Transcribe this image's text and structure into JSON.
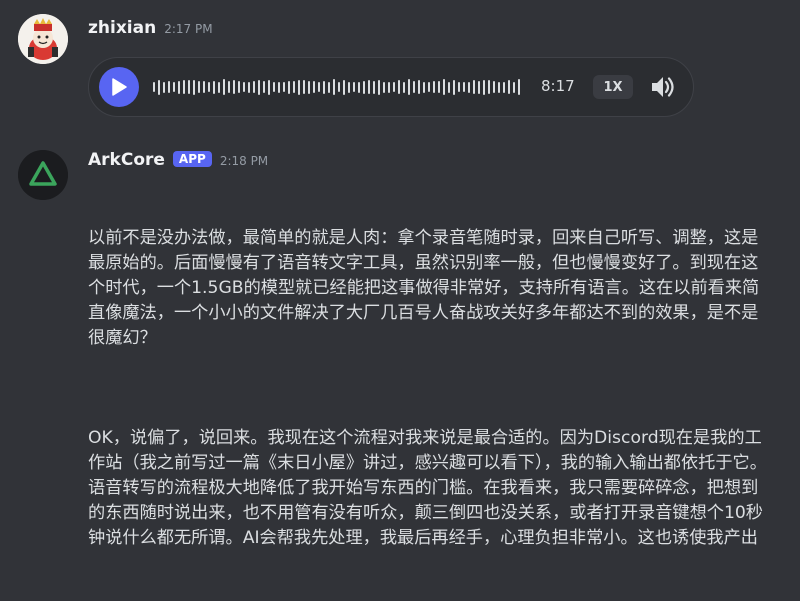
{
  "messages": [
    {
      "username": "zhixian",
      "timestamp": "2:17 PM",
      "avatar": "red-crowned-character-avatar",
      "voice": {
        "duration": "8:17",
        "speed": "1X",
        "play_icon": "play-icon",
        "volume_icon": "speaker-icon"
      }
    },
    {
      "username": "ArkCore",
      "badge": "APP",
      "timestamp": "2:18 PM",
      "avatar": "green-triangle-avatar",
      "paragraphs": [
        "以前不是没办法做，最简单的就是人肉：拿个录音笔随时录，回来自己听写、调整，这是最原始的。后面慢慢有了语音转文字工具，虽然识别率一般，但也慢慢变好了。到现在这个时代，一个1.5GB的模型就已经能把这事做得非常好，支持所有语言。这在以前看来简直像魔法，一个小小的文件解决了大厂几百号人奋战攻关好多年都达不到的效果，是不是很魔幻？",
        "OK，说偏了，说回来。我现在这个流程对我来说是最合适的。因为Discord现在是我的工作站（我之前写过一篇《末日小屋》讲过，感兴趣可以看下），我的输入输出都依托于它。语音转写的流程极大地降低了我开始写东西的门槛。在我看来，我只需要碎碎念，把想到的东西随时说出来，也不用管有没有听众，颠三倒四也没关系，或者打开录音键想个10秒钟说什么都无所谓。AI会帮我先处理，我最后再经手，心理负担非常小。这也诱使我产出"
      ]
    }
  ],
  "colors": {
    "background": "#313338",
    "accent": "#5865f2",
    "text": "#dbdee1",
    "muted": "#949ba4",
    "triangle": "#3ba55c"
  }
}
